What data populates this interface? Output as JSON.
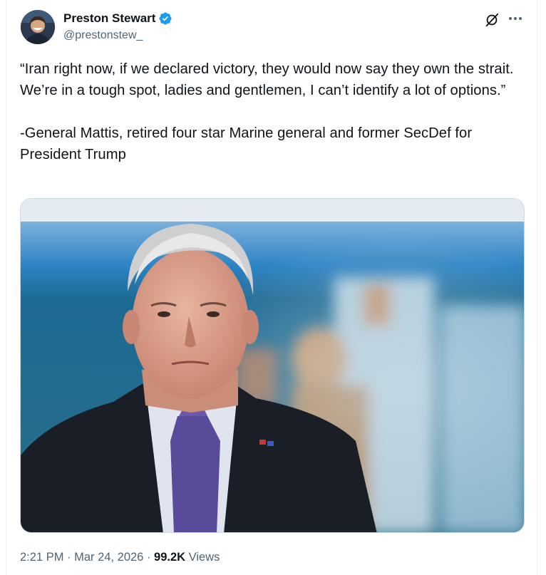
{
  "author": {
    "display_name": "Preston Stewart",
    "handle": "@prestonstew_",
    "verified": true,
    "verified_color": "#1d9bf0"
  },
  "icons": {
    "verified": "verified-badge-icon",
    "grok": "grok-icon",
    "more": "more-options-icon"
  },
  "tweet": {
    "quote_paragraph": "“Iran right now, if we declared victory, they would now say they own the strait.  We’re in a tough spot, ladies and gentlemen, I can’t identify a lot of options.”",
    "attribution_paragraph": "-General Mattis, retired four star Marine general and former SecDef for President Trump"
  },
  "meta": {
    "time": "2:21 PM",
    "separator": " · ",
    "date": "Mar 24, 2026",
    "views_count": "99.2K",
    "views_label": " Views"
  },
  "colors": {
    "text_primary": "#0f1419",
    "text_secondary": "#536471",
    "accent": "#1d9bf0"
  }
}
